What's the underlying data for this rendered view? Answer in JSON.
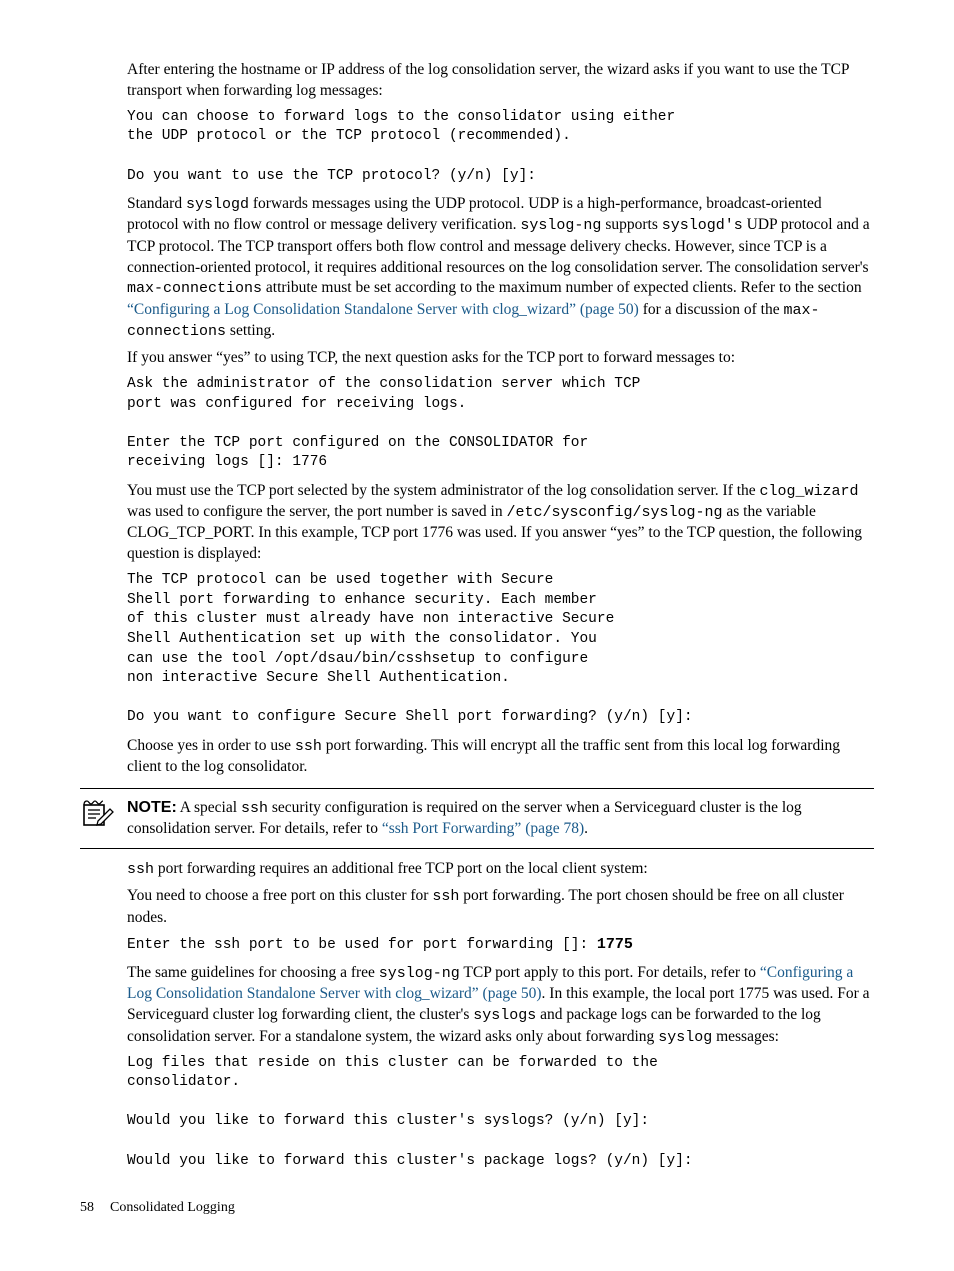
{
  "p1": "After entering the hostname or IP address of the log consolidation server, the wizard asks if you want to use the TCP transport when forwarding log messages:",
  "code1": "You can choose to forward logs to the consolidator using either\nthe UDP protocol or the TCP protocol (recommended).\n\nDo you want to use the TCP protocol? (y/n) [y]:",
  "p2_a": "Standard ",
  "p2_b": " forwards messages using the UDP protocol. UDP is a high-performance, broadcast-oriented protocol with no flow control or message delivery verification. ",
  "p2_c": " supports ",
  "p2_d": " UDP protocol and a  TCP protocol. The TCP transport offers both flow control and message delivery checks. However, since TCP is a connection-oriented protocol, it requires additional resources on the log consolidation server. The consolidation server's ",
  "p2_e": " attribute must be set according to the maximum number of expected clients. Refer to the section ",
  "p2_f": " for a discussion of the ",
  "p2_g": " setting.",
  "mono": {
    "syslogd": "syslogd",
    "syslog_ng": "syslog-ng",
    "syslogds": "syslogd's",
    "max_conn": "max-connections",
    "clog_wizard": "clog_wizard",
    "syscfg": "/etc/sysconfig/syslog-ng",
    "ssh": "ssh",
    "syslogs": "syslogs",
    "syslog": "syslog"
  },
  "link1": "“Configuring a Log Consolidation Standalone Server with clog_wizard” (page 50)",
  "p3": "If you answer “yes” to using TCP, the next question asks for the TCP port to forward messages to:",
  "code2": "Ask the administrator of the consolidation server which TCP\nport was configured for receiving logs.\n\nEnter the TCP port configured on the CONSOLIDATOR for\nreceiving logs []: 1776",
  "p4_a": "You must use the TCP port selected by the system administrator of the log consolidation server. If the ",
  "p4_b": " was used to configure the server, the port number is saved in ",
  "p4_c": " as the variable CLOG_TCP_PORT. In this example, TCP port 1776 was used. If you answer “yes” to the TCP question, the following question is displayed:",
  "code3": "The TCP protocol can be used together with Secure\nShell port forwarding to enhance security. Each member\nof this cluster must already have non interactive Secure\nShell Authentication set up with the consolidator. You\ncan use the tool /opt/dsau/bin/csshsetup to configure\nnon interactive Secure Shell Authentication.\n\nDo you want to configure Secure Shell port forwarding? (y/n) [y]:",
  "p5_a": "Choose yes in order to use ",
  "p5_b": " port forwarding. This will encrypt all the traffic sent from this local log forwarding client to the log consolidator.",
  "note_label": "NOTE:",
  "note_a": "   A special ",
  "note_b": " security configuration is required on the server when a Serviceguard cluster is the log consolidation server. For details, refer to ",
  "link2": "“ssh Port Forwarding” (page 78)",
  "note_c": ".",
  "p6_a": " port forwarding requires an additional free TCP port on the local client system:",
  "p7_a": "You need to choose a free port on this cluster for ",
  "p7_b": " port forwarding. The port chosen should be free on all cluster nodes.",
  "code4_a": "Enter the ssh port to be used for port forwarding []: ",
  "code4_b": "1775",
  "p8_a": "The same guidelines for choosing a free ",
  "p8_b": " TCP port apply to this port. For details, refer to ",
  "link3": "“Configuring a Log Consolidation Standalone Server with clog_wizard” (page 50)",
  "p8_c": ". In this example, the local port 1775 was used. For a Serviceguard cluster log forwarding client, the cluster's ",
  "p8_d": " and package logs can be forwarded to the log consolidation server. For a standalone system, the wizard asks only about forwarding ",
  "p8_e": " messages:",
  "code5": "Log files that reside on this cluster can be forwarded to the\nconsolidator.\n\nWould you like to forward this cluster's syslogs? (y/n) [y]:\n\nWould you like to forward this cluster's package logs? (y/n) [y]:",
  "footer": {
    "page": "58",
    "section": "Consolidated Logging"
  }
}
